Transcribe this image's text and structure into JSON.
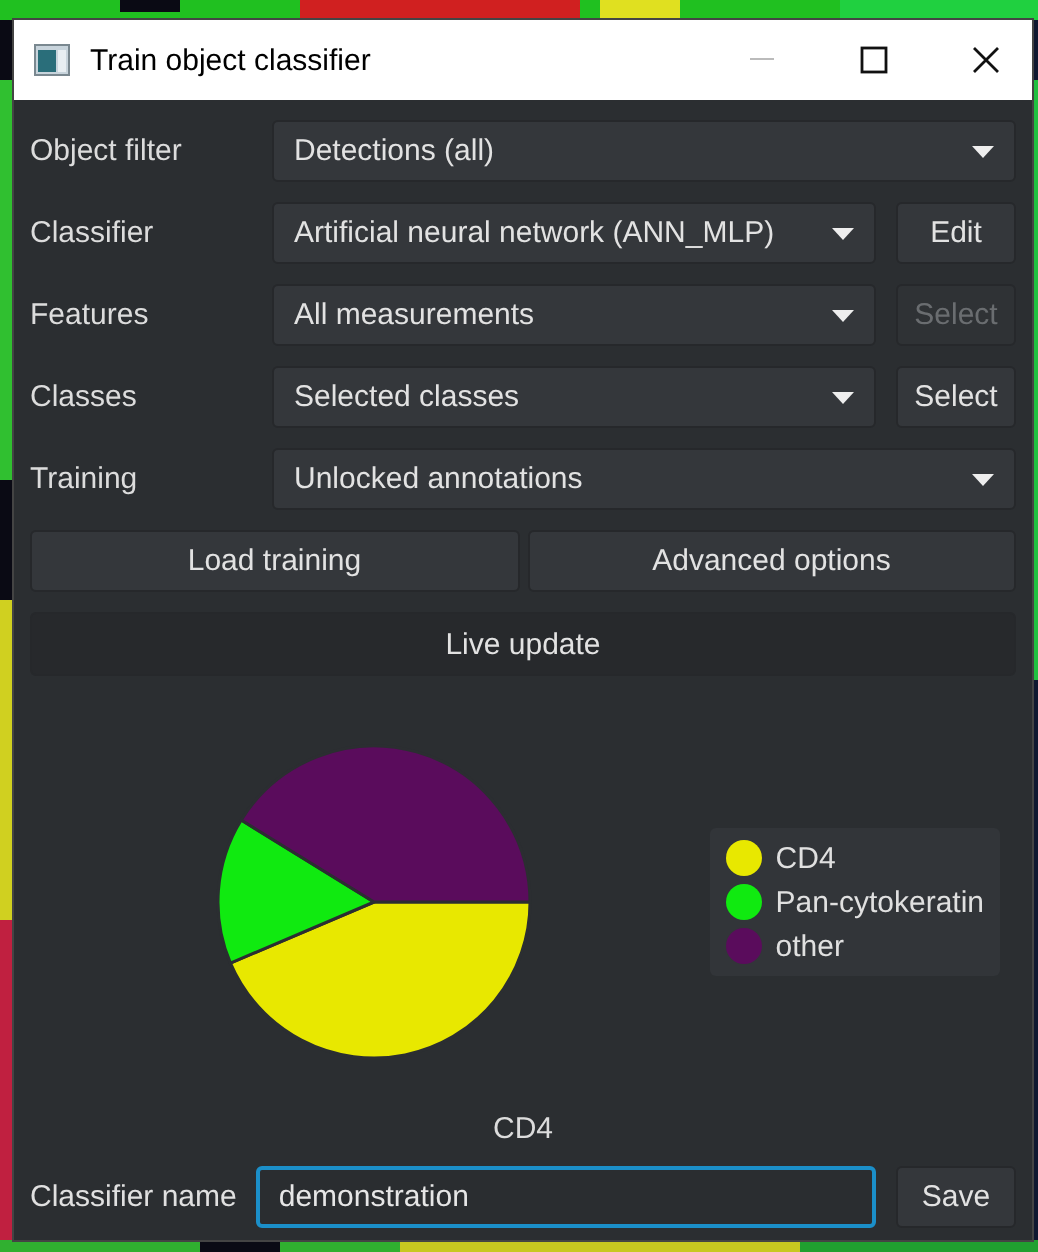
{
  "window": {
    "title": "Train object classifier"
  },
  "rows": [
    {
      "label": "Object filter",
      "value": "Detections (all)"
    },
    {
      "label": "Classifier",
      "value": "Artificial neural network (ANN_MLP)",
      "button": {
        "label": "Edit",
        "disabled": false
      }
    },
    {
      "label": "Features",
      "value": "All measurements",
      "button": {
        "label": "Select",
        "disabled": true
      }
    },
    {
      "label": "Classes",
      "value": "Selected classes",
      "button": {
        "label": "Select",
        "disabled": false
      }
    },
    {
      "label": "Training",
      "value": "Unlocked annotations"
    }
  ],
  "buttons": [
    {
      "label": "Load training"
    },
    {
      "label": "Advanced options"
    }
  ],
  "live_update": {
    "label": "Live update"
  },
  "legend": [
    {
      "label": "CD4",
      "color": "#e8e800"
    },
    {
      "label": "Pan-cytokeratin",
      "color": "#10ea10"
    },
    {
      "label": "other",
      "color": "#5a0c5c"
    }
  ],
  "chart_caption": "CD4",
  "classifier_name": {
    "label": "Classifier name",
    "value": "demonstration",
    "focused": true
  },
  "save_button": {
    "label": "Save"
  }
}
